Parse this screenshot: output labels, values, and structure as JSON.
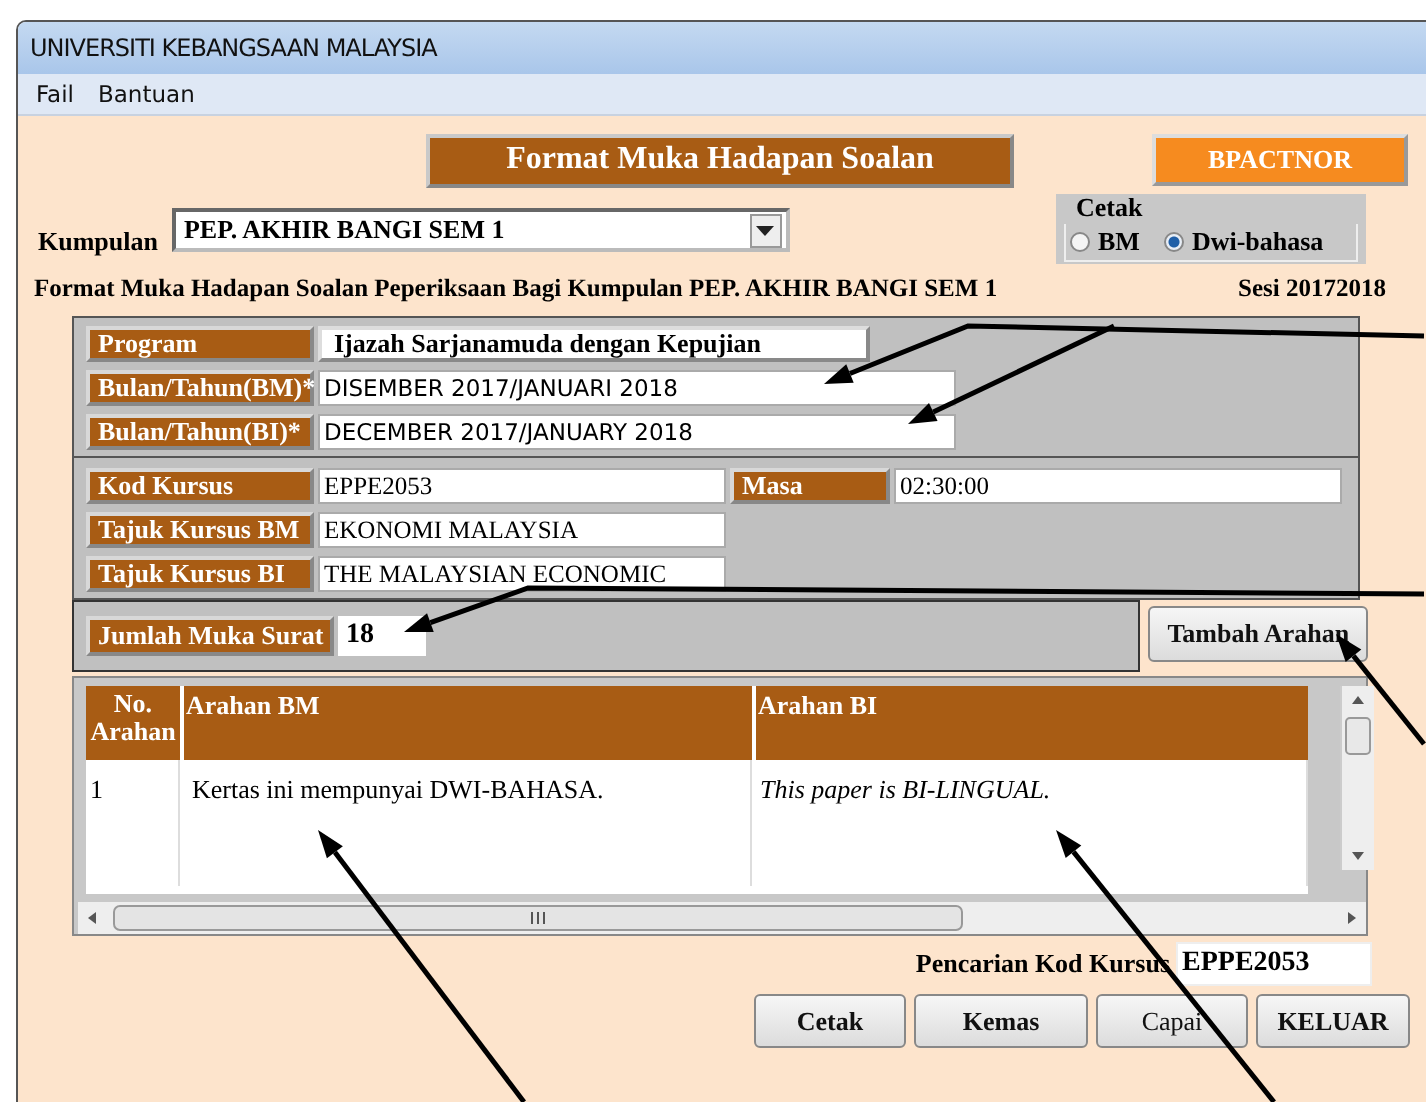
{
  "window": {
    "title": "UNIVERSITI KEBANGSAAN MALAYSIA"
  },
  "menu": [
    "Fail",
    "Bantuan"
  ],
  "header": {
    "title": "Format Muka Hadapan Soalan",
    "code": "BPACTNOR"
  },
  "group": {
    "label": "Kumpulan",
    "value": "PEP. AKHIR BANGI SEM 1"
  },
  "print_mode": {
    "title": "Cetak",
    "options": [
      {
        "label": "BM",
        "selected": false
      },
      {
        "label": "Dwi-bahasa",
        "selected": true
      }
    ]
  },
  "info": {
    "text": "Format Muka Hadapan Soalan Peperiksaan Bagi Kumpulan PEP. AKHIR BANGI SEM 1",
    "session": "Sesi 20172018"
  },
  "sections": [
    [
      [
        {
          "label": "Program",
          "value": "Ijazah Sarjanamuda dengan Kepujian"
        }
      ],
      [
        {
          "label": "Bulan/Tahun(BM)*",
          "value": "DISEMBER 2017/JANUARI 2018"
        }
      ],
      [
        {
          "label": "Bulan/Tahun(BI)*",
          "value": "DECEMBER 2017/JANUARY 2018"
        }
      ]
    ],
    [
      [
        {
          "label": "Kod Kursus",
          "value": "EPPE2053"
        },
        {
          "label": "Masa",
          "value": "02:30:00"
        }
      ],
      [
        {
          "label": "Tajuk Kursus BM",
          "value": "EKONOMI MALAYSIA"
        }
      ],
      [
        {
          "label": "Tajuk Kursus BI",
          "value": "THE MALAYSIAN ECONOMIC"
        }
      ]
    ]
  ],
  "pages": {
    "label": "Jumlah Muka Surat",
    "value": "18"
  },
  "add_button": "Tambah Arahan",
  "table": {
    "columns": [
      "No. Arahan",
      "Arahan BM",
      "Arahan BI"
    ],
    "rows": [
      [
        "1",
        "Kertas ini mempunyai DWI-BAHASA.",
        "This paper is BI-LINGUAL."
      ]
    ]
  },
  "search": {
    "label": "Pencarian Kod Kursus",
    "value": "EPPE2053"
  },
  "buttons": [
    "Cetak",
    "Kemas",
    "Capai",
    "KELUAR"
  ]
}
